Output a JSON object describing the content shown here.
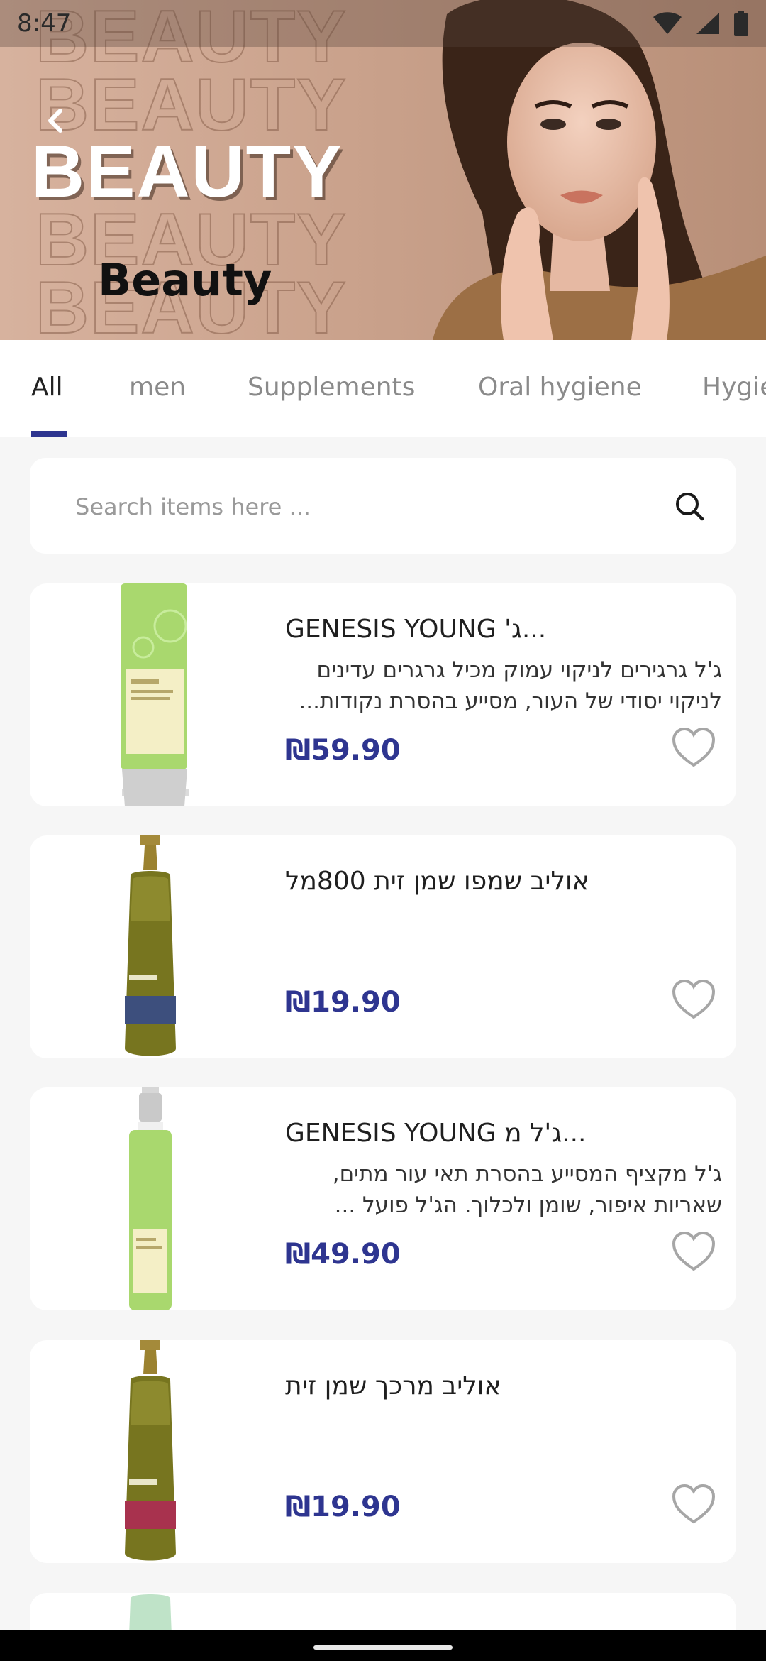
{
  "status_bar": {
    "time": "8:47"
  },
  "hero": {
    "banner_word": "BEAUTY",
    "title": "Beauty"
  },
  "tabs": [
    {
      "label": "All"
    },
    {
      "label": "men"
    },
    {
      "label": "Supplements"
    },
    {
      "label": "Oral hygiene"
    },
    {
      "label": "Hygie"
    }
  ],
  "search": {
    "placeholder": "Search items here ..."
  },
  "products": [
    {
      "title": "GENESIS YOUNG 'ג...",
      "description": "ג'ל גרגירים לניקוי עמוק מכיל גרגרים עדינים לניקוי יסודי של העור, מסייע בהסרת נקודות...",
      "price": "₪59.90"
    },
    {
      "title": "אוליב שמפו שמן זית 800מל",
      "description": "",
      "price": "₪19.90"
    },
    {
      "title": "GENESIS YOUNG ג'ל מ...",
      "description": "ג'ל מקציף המסייע בהסרת תאי עור מתים, שאריות איפור, שומן ולכלוך. הג'ל פועל ...",
      "price": "₪49.90"
    },
    {
      "title": "אוליב מרכך שמן זית",
      "description": "",
      "price": "₪19.90"
    }
  ],
  "colors": {
    "accent": "#2e3590",
    "background": "#f6f6f6"
  }
}
